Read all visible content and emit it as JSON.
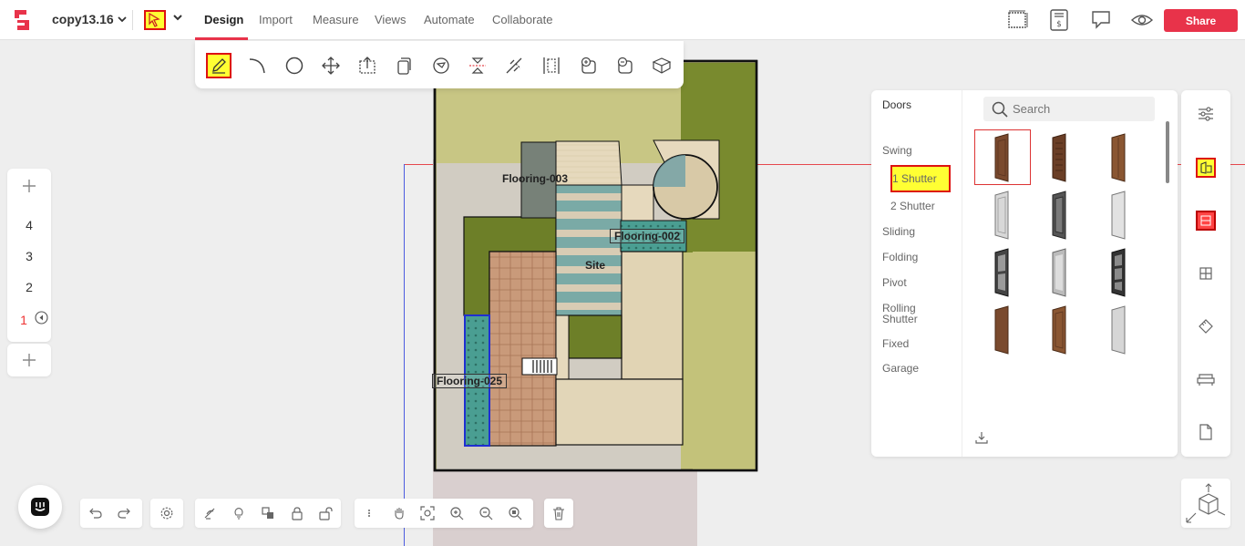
{
  "header": {
    "project_name": "copy13.16",
    "tabs": [
      {
        "label": "Design"
      },
      {
        "label": "Import"
      },
      {
        "label": "Measure"
      },
      {
        "label": "Views"
      },
      {
        "label": "Automate"
      },
      {
        "label": "Collaborate"
      }
    ],
    "share_label": "Share",
    "accent_color": "#e8334a"
  },
  "tools": [
    "pencil-icon",
    "arc-icon",
    "circle-icon",
    "move-icon",
    "transform-icon",
    "copy-icon",
    "rotate-icon",
    "mirror-icon",
    "split-icon",
    "align-icon",
    "add-shape-icon",
    "subtract-shape-icon",
    "extrude-icon"
  ],
  "canvas": {
    "labels": {
      "flooring_003": "Flooring-003",
      "flooring_002": "Flooring-002",
      "site": "Site",
      "flooring_025": "Flooring-025"
    }
  },
  "floors": {
    "items": [
      "4",
      "3",
      "2",
      "1"
    ],
    "active": "1"
  },
  "library": {
    "title": "Doors",
    "categories": [
      "Swing",
      "1 Shutter",
      "2 Shutter",
      "Sliding",
      "Folding",
      "Pivot",
      "Rolling Shutter",
      "Fixed",
      "Garage"
    ],
    "selected_category": "1 Shutter",
    "search_placeholder": "Search"
  },
  "rail_icons": [
    "sliders-icon",
    "door-library-icon",
    "window-library-icon",
    "grid-icon",
    "ruler-icon",
    "sofa-icon",
    "document-icon"
  ]
}
